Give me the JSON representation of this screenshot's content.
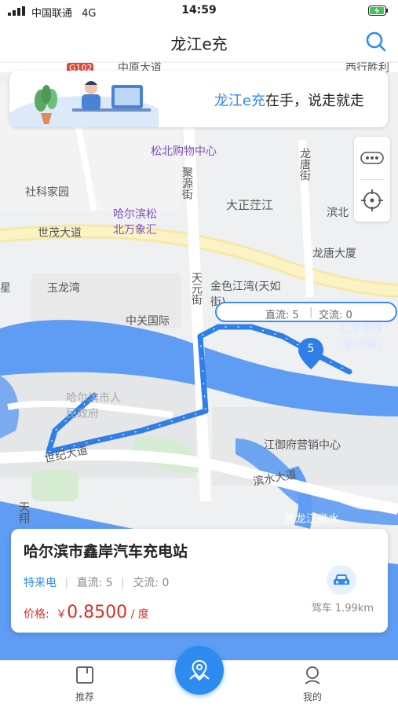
{
  "status": {
    "carrier": "中国联通",
    "network": "4G",
    "time": "14:59"
  },
  "header": {
    "title": "龙江e充"
  },
  "banner": {
    "brand": "龙江e充",
    "slogan_rest": "在手，说走就走"
  },
  "map": {
    "labels": [
      "G102",
      "中原大道",
      "西行胜利",
      "松北购物中心",
      "社科家园",
      "聚源街",
      "龙唐街",
      "大正茳江",
      "滨北",
      "哈尔滨松北万象汇",
      "世茂大道",
      "龙唐大厦",
      "玉龙湾",
      "星",
      "天元街",
      "金色江湾(天如街)",
      "中关国际",
      "北岸明珠(新湾路)",
      "哈尔滨市人民政府",
      "世纪大道",
      "江御府营销中心",
      "滨水大道",
      "天翔",
      "黑龙江省水上运动中心"
    ],
    "callout": {
      "dc": "直流: 5",
      "ac": "交流: 0"
    },
    "pin_count": "5"
  },
  "station": {
    "name": "哈尔滨市鑫岸汽车充电站",
    "tag": "特来电",
    "dc": "直流: 5",
    "ac": "交流: 0",
    "price_label": "价格:",
    "currency": "￥",
    "price": "0.8500",
    "unit": "/ 度",
    "distance": "驾车 1.99km"
  },
  "tabs": {
    "recommend": "推荐",
    "mine": "我的"
  },
  "colors": {
    "accent": "#2e8bf0",
    "price": "#d93025",
    "route": "#3a8ef0"
  }
}
